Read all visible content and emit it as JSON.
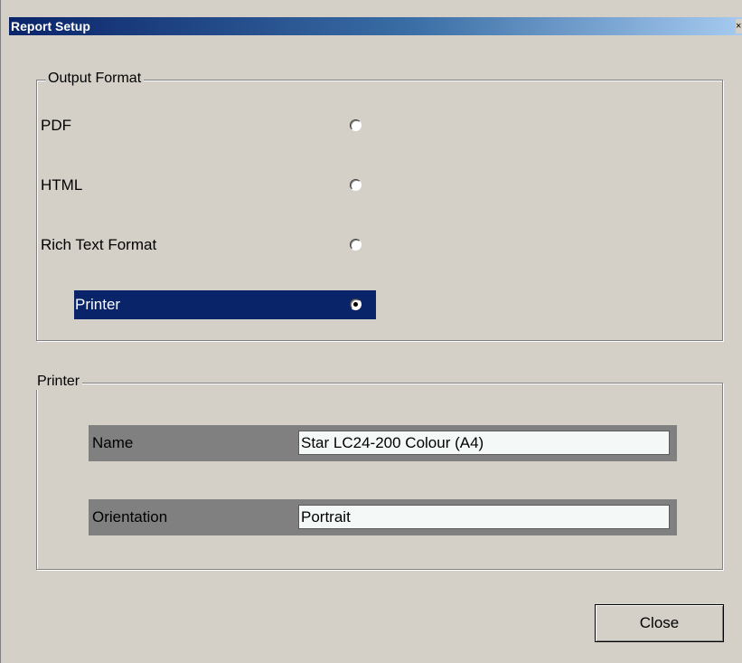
{
  "window": {
    "title": "Report Setup",
    "close_glyph": "×"
  },
  "output_format": {
    "legend": "Output Format",
    "options": [
      {
        "label": "PDF",
        "selected": false
      },
      {
        "label": "HTML",
        "selected": false
      },
      {
        "label": "Rich Text Format",
        "selected": false
      },
      {
        "label": "Printer",
        "selected": true
      }
    ]
  },
  "printer": {
    "legend": "Printer",
    "fields": [
      {
        "label": "Name",
        "value": "Star LC24-200 Colour (A4)"
      },
      {
        "label": "Orientation",
        "value": "Portrait"
      }
    ]
  },
  "buttons": {
    "close_label": "Close"
  },
  "colors": {
    "title_bar_start": "#0a246a",
    "title_bar_end": "#a6caf0",
    "dialog_background": "#d4d0c8",
    "selection": "#0a246a",
    "field_row": "#808080"
  }
}
